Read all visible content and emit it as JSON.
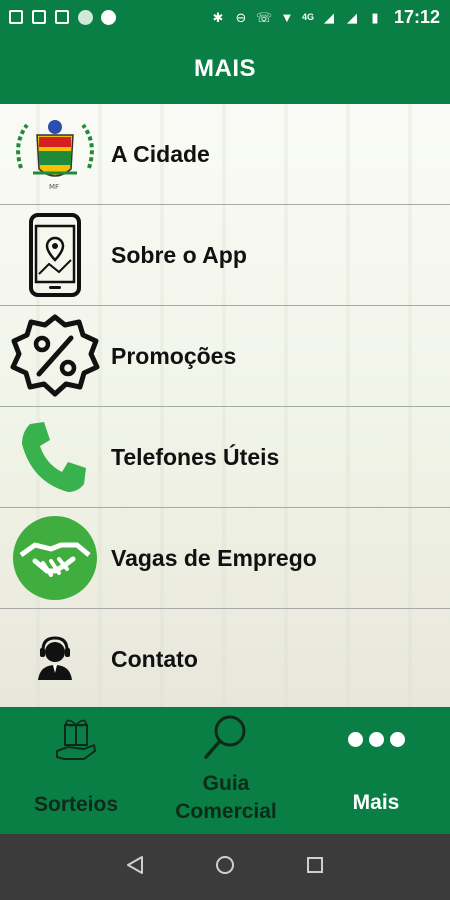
{
  "status_bar": {
    "time": "17:12",
    "network_label": "4G",
    "signal_label": "4G",
    "colors": {
      "background": "#0a7f45"
    }
  },
  "app_bar": {
    "title": "MAIS"
  },
  "menu": {
    "items": [
      {
        "label": "A Cidade",
        "icon": "city-crest-icon"
      },
      {
        "label": "Sobre o App",
        "icon": "phone-location-icon"
      },
      {
        "label": "Promoções",
        "icon": "percent-badge-icon"
      },
      {
        "label": "Telefones Úteis",
        "icon": "phone-handset-icon"
      },
      {
        "label": "Vagas de Emprego",
        "icon": "handshake-icon"
      },
      {
        "label": "Contato",
        "icon": "support-agent-icon"
      }
    ]
  },
  "bottom_nav": {
    "items": [
      {
        "label": "Sorteios",
        "icon": "gift-hand-icon",
        "active": false
      },
      {
        "label_line1": "Guia",
        "label_line2": "Comercial",
        "icon": "search-icon",
        "active": false
      },
      {
        "label": "Mais",
        "icon": "more-dots-icon",
        "active": true
      }
    ]
  },
  "colors": {
    "primary": "#0a7f45",
    "accent_green": "#3fae3f",
    "active_label": "#ffffff",
    "inactive_label": "#0d2a1a"
  }
}
